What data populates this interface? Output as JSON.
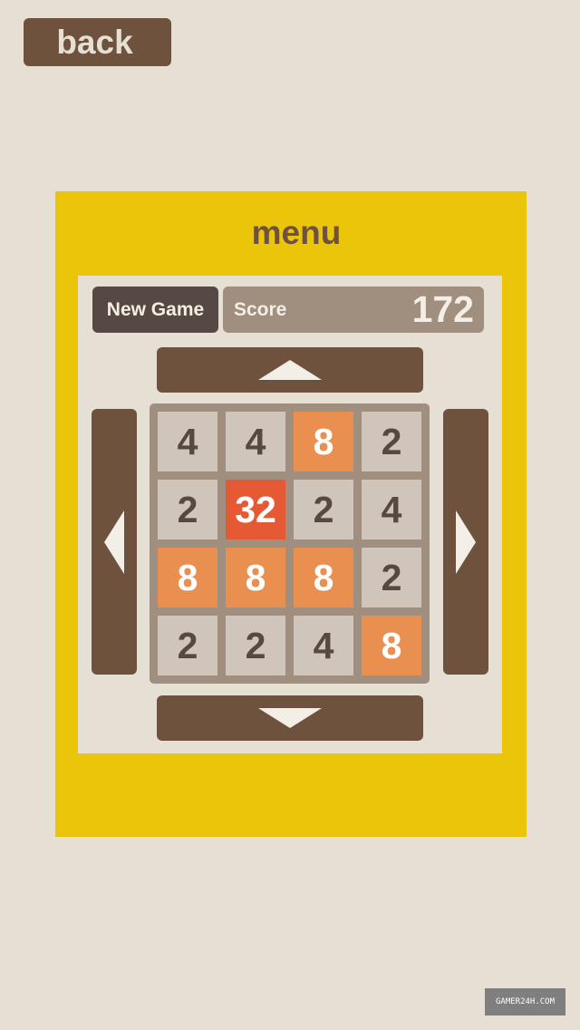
{
  "header": {
    "back_label": "back"
  },
  "panel": {
    "title": "menu"
  },
  "toolbar": {
    "new_game_label": "New Game"
  },
  "score": {
    "label": "Score",
    "value": "172"
  },
  "board": {
    "tiles": [
      [
        "4",
        "4",
        "8",
        "2"
      ],
      [
        "2",
        "32",
        "2",
        "4"
      ],
      [
        "8",
        "8",
        "8",
        "2"
      ],
      [
        "2",
        "2",
        "4",
        "8"
      ]
    ]
  },
  "controls": {
    "up_icon": "triangle-up-icon",
    "down_icon": "triangle-down-icon",
    "left_icon": "triangle-left-icon",
    "right_icon": "triangle-right-icon"
  },
  "colors": {
    "background": "#e6dfd3",
    "panel": "#eac50a",
    "button_brown": "#6e523e",
    "grid": "#a08e7e",
    "tile_empty_dark_text": "#564842",
    "tile_2_4": "#d0c5ba",
    "tile_8": "#e98f50",
    "tile_32": "#e55a35"
  },
  "watermark": {
    "text": "GAMER24H.COM"
  }
}
